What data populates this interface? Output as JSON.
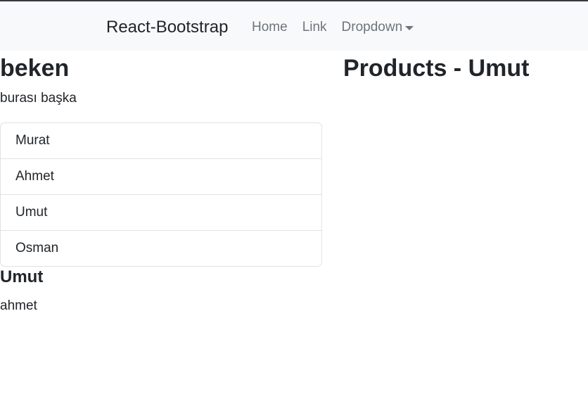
{
  "navbar": {
    "brand": "React-Bootstrap",
    "links": [
      "Home",
      "Link"
    ],
    "dropdown_label": "Dropdown"
  },
  "left": {
    "heading": "beken",
    "subtitle": "burası başka",
    "list_items": [
      "Murat",
      "Ahmet",
      "Umut",
      "Osman"
    ],
    "selected_heading": "Umut",
    "selected_text": "ahmet"
  },
  "right": {
    "heading": "Products - Umut"
  },
  "colors": {
    "navbar_bg": "#f8f9fa",
    "text": "#212529",
    "nav_link": "#6c757d",
    "border": "#dee2e6"
  }
}
